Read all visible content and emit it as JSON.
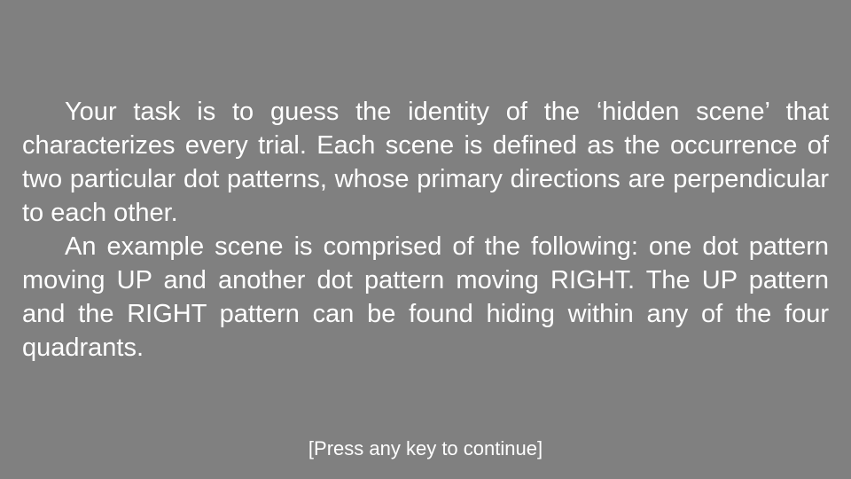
{
  "instructions": {
    "paragraphs": [
      "Your task is to guess the identity of the ‘hidden scene’ that characterizes every trial. Each scene is defined as the occurrence of two particular dot patterns, whose primary directions are perpendicular to each other.",
      "An example scene is comprised of the following: one dot pattern moving UP and another dot pattern moving RIGHT. The UP pattern and the RIGHT pattern can be found hiding within any of the four quadrants."
    ]
  },
  "prompt": {
    "continue_text": "[Press any key to continue]"
  },
  "colors": {
    "background": "#808080",
    "text": "#ffffff"
  }
}
